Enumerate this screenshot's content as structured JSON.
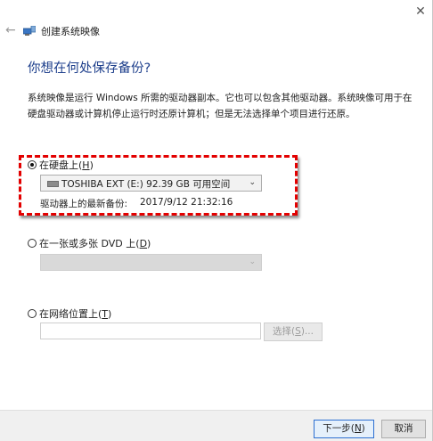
{
  "window": {
    "title": "创建系统映像",
    "close_glyph": "✕",
    "back_glyph": "←"
  },
  "heading": "你想在何处保存备份?",
  "description": "系统映像是运行 Windows 所需的驱动器副本。它也可以包含其他驱动器。系统映像可用于在硬盘驱动器或计算机停止运行时还原计算机；但是无法选择单个项目进行还原。",
  "options": {
    "hard_disk": {
      "label": "在硬盘上(",
      "hotkey": "H",
      "suffix": ")",
      "selected": true,
      "drive_selected": "TOSHIBA EXT (E:)  92.39 GB 可用空间",
      "last_backup_label": "驱动器上的最新备份:",
      "last_backup_value": "2017/9/12 21:32:16"
    },
    "dvd": {
      "label": "在一张或多张 DVD 上(",
      "hotkey": "D",
      "suffix": ")",
      "selected": false,
      "drive_selected": ""
    },
    "network": {
      "label": "在网络位置上(",
      "hotkey": "T",
      "suffix": ")",
      "selected": false,
      "path_value": "",
      "browse_label": "选择(",
      "browse_hotkey": "S",
      "browse_suffix": ")..."
    }
  },
  "buttons": {
    "next_label": "下一步(",
    "next_hotkey": "N",
    "next_suffix": ")",
    "cancel_label": "取消"
  },
  "colors": {
    "heading": "#1e3f8c",
    "highlight": "#e30000",
    "primary_button_border": "#2c6fd1"
  }
}
